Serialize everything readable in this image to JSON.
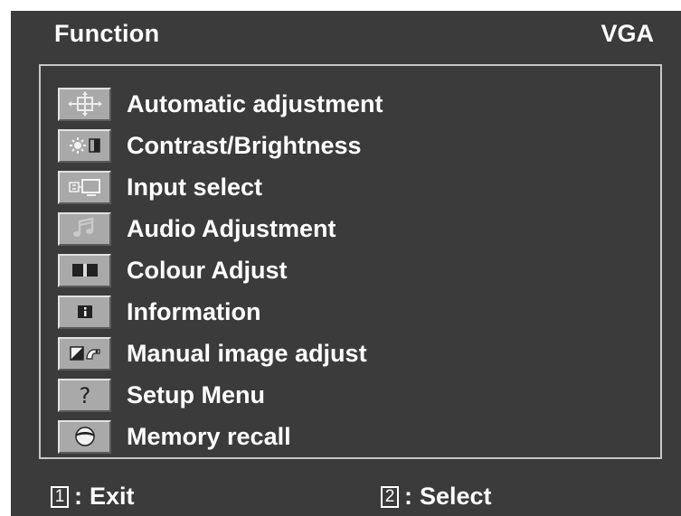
{
  "header": {
    "title": "Function",
    "input_source": "VGA"
  },
  "menu": {
    "items": [
      {
        "label": "Automatic adjustment",
        "icon": "auto-adjust-icon"
      },
      {
        "label": "Contrast/Brightness",
        "icon": "contrast-brightness-icon"
      },
      {
        "label": "Input select",
        "icon": "input-select-icon"
      },
      {
        "label": "Audio Adjustment",
        "icon": "audio-icon"
      },
      {
        "label": "Colour Adjust",
        "icon": "colour-icon"
      },
      {
        "label": "Information",
        "icon": "information-icon"
      },
      {
        "label": "Manual image adjust",
        "icon": "manual-image-icon"
      },
      {
        "label": "Setup Menu",
        "icon": "setup-help-icon"
      },
      {
        "label": "Memory recall",
        "icon": "memory-recall-icon"
      }
    ]
  },
  "footer": {
    "exit": {
      "key": "1",
      "separator": ":",
      "label": "Exit"
    },
    "select": {
      "key": "2",
      "separator": ":",
      "label": "Select"
    }
  },
  "colors": {
    "background": "#3b3b3b",
    "text": "#ffffff",
    "icon_face": "#a9a9a9",
    "frame": "#c7c7c7"
  }
}
